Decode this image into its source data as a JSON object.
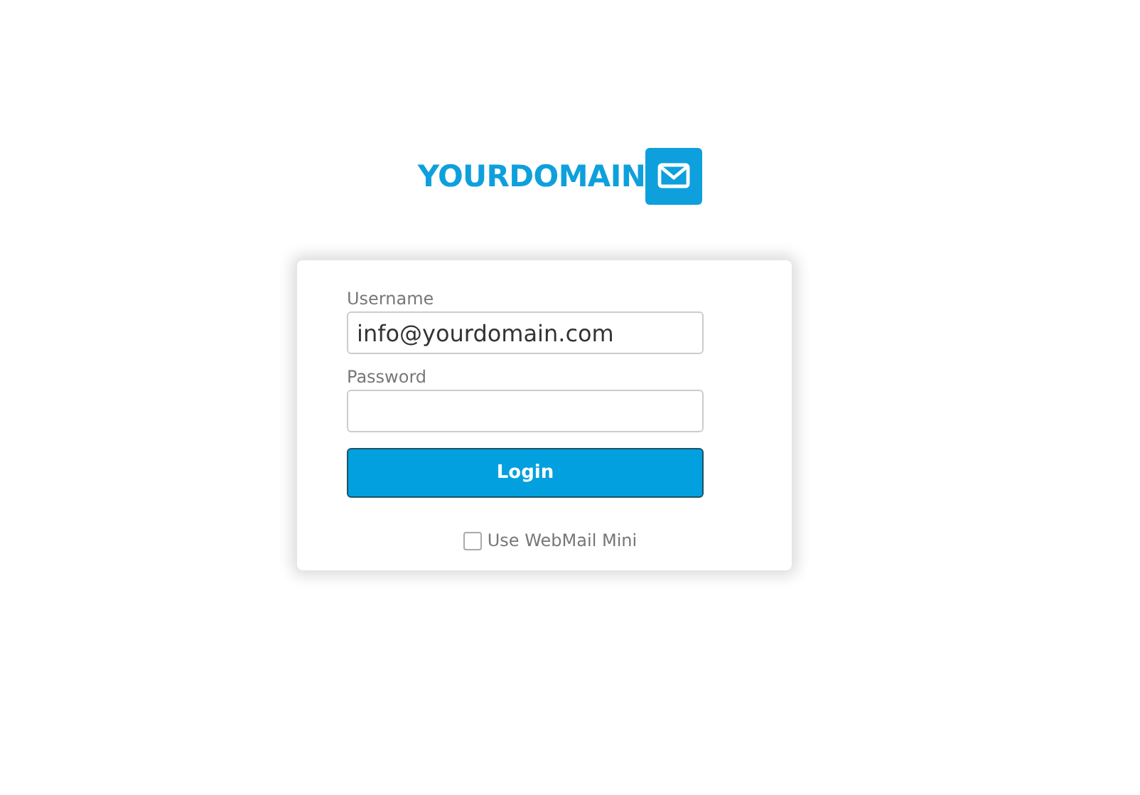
{
  "logo": {
    "text": "YOURDOMAIN"
  },
  "form": {
    "username": {
      "label": "Username",
      "value": "info@yourdomain.com"
    },
    "password": {
      "label": "Password"
    },
    "login_button": "Login",
    "mini_option": {
      "label": "Use WebMail Mini",
      "checked": false
    }
  }
}
